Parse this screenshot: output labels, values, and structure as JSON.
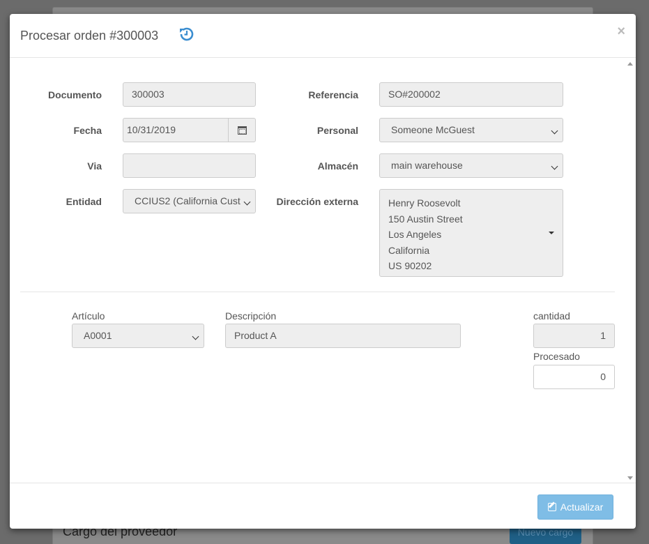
{
  "background": {
    "section_title": "Cargo del proveedor",
    "new_button": "Nuevo cargo"
  },
  "modal": {
    "title": "Procesar orden #300003",
    "close": "×",
    "update_button": "Actualizar"
  },
  "form": {
    "documento": {
      "label": "Documento",
      "value": "300003"
    },
    "referencia": {
      "label": "Referencia",
      "value": "SO#200002"
    },
    "fecha": {
      "label": "Fecha",
      "value": "10/31/2019"
    },
    "personal": {
      "label": "Personal",
      "value": "Someone McGuest"
    },
    "via": {
      "label": "Via",
      "value": ""
    },
    "almacen": {
      "label": "Almacén",
      "value": "main warehouse"
    },
    "entidad": {
      "label": "Entidad",
      "value": "CCIUS2 (California Cust"
    },
    "direccion": {
      "label": "Dirección externa",
      "lines": [
        "Henry Roosevolt",
        "150 Austin Street",
        "Los Angeles",
        "California",
        "US 90202"
      ]
    }
  },
  "line_item": {
    "articulo": {
      "label": "Artículo",
      "value": "A0001"
    },
    "descripcion": {
      "label": "Descripción",
      "value": "Product A"
    },
    "cantidad": {
      "label": "cantidad",
      "value": "1"
    },
    "procesado": {
      "label": "Procesado",
      "value": "0"
    }
  },
  "colors": {
    "accent": "#3a8dd0",
    "button": "#7fbde6"
  },
  "icons": {
    "history": "history-icon",
    "calendar": "calendar-icon",
    "edit": "edit-icon"
  }
}
